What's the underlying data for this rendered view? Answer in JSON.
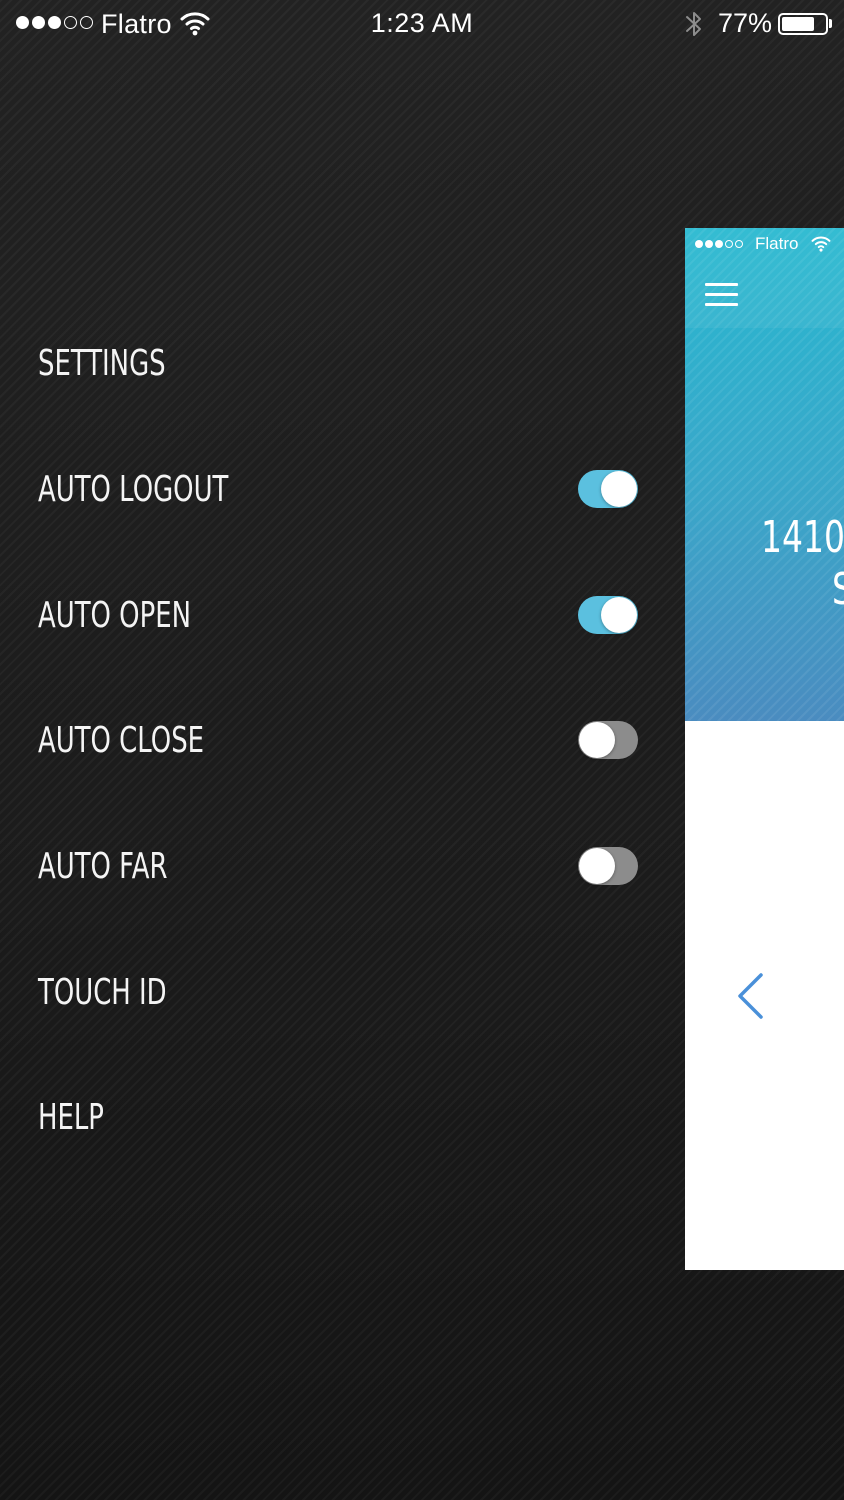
{
  "status_bar": {
    "carrier": "Flatro",
    "time": "1:23 AM",
    "battery_percent": "77%",
    "battery_level": 0.77,
    "signal_bars_filled": 3,
    "signal_bars_total": 5,
    "icons": [
      "signal-dots-icon",
      "wifi-icon",
      "bluetooth-icon",
      "battery-icon"
    ]
  },
  "menu": {
    "title": "SETTINGS",
    "items": [
      {
        "label": "AUTO LOGOUT",
        "toggle": true
      },
      {
        "label": "AUTO OPEN",
        "toggle": true
      },
      {
        "label": "AUTO CLOSE",
        "toggle": false
      },
      {
        "label": "AUTO FAR",
        "toggle": false
      },
      {
        "label": "TOUCH ID"
      },
      {
        "label": "HELP"
      }
    ]
  },
  "preview": {
    "carrier": "Flatro",
    "number_text": "1410",
    "partial_text": "S",
    "icons": [
      "hamburger-menu-icon",
      "chevron-left-icon"
    ]
  },
  "colors": {
    "background": "#1d1d1d",
    "toggle_on": "#5bc0df",
    "toggle_off": "#8c8c8c",
    "preview_gradient_top": "#27b8d0",
    "preview_gradient_bottom": "#4a8cc0",
    "chevron": "#4a90d9"
  }
}
